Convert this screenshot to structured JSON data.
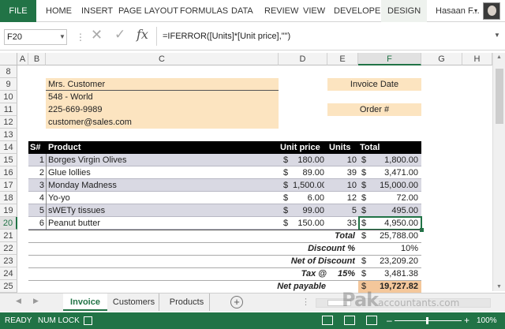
{
  "ribbon": {
    "file": "FILE",
    "tabs": [
      "HOME",
      "INSERT",
      "PAGE LAYOUT",
      "FORMULAS",
      "DATA",
      "REVIEW",
      "VIEW",
      "DEVELOPER"
    ],
    "design": "DESIGN",
    "user": "Hasaan F...",
    "user_caret": "▾"
  },
  "formula_bar": {
    "name_box": "F20",
    "formula": "=IFERROR([Units]*[Unit price],\"\")",
    "cancel_icon": "✕",
    "enter_icon": "✓",
    "fx": "fx"
  },
  "columns": [
    "A",
    "B",
    "C",
    "D",
    "E",
    "F",
    "G",
    "H"
  ],
  "selected_column": "F",
  "rows": [
    "8",
    "9",
    "10",
    "11",
    "12",
    "13",
    "14",
    "15",
    "16",
    "17",
    "18",
    "19",
    "20",
    "21",
    "22",
    "23",
    "24",
    "25"
  ],
  "selected_row": "20",
  "customer": {
    "name": "Mrs. Customer",
    "address": "548 - World",
    "phone": "225-669-9989",
    "email": "customer@sales.com"
  },
  "invoice_date_label": "Invoice Date",
  "order_label": "Order #",
  "table": {
    "headers": [
      "S#",
      "Product",
      "Unit price",
      "Units",
      "Total"
    ],
    "rows": [
      {
        "sn": "1",
        "product": "Borges Virgin Olives",
        "cur": "$",
        "price": "180.00",
        "units": "10",
        "tcur": "$",
        "total": "1,800.00"
      },
      {
        "sn": "2",
        "product": "Glue lollies",
        "cur": "$",
        "price": "89.00",
        "units": "39",
        "tcur": "$",
        "total": "3,471.00"
      },
      {
        "sn": "3",
        "product": "Monday Madness",
        "cur": "$",
        "price": "1,500.00",
        "units": "10",
        "tcur": "$",
        "total": "15,000.00"
      },
      {
        "sn": "4",
        "product": "Yo-yo",
        "cur": "$",
        "price": "6.00",
        "units": "12",
        "tcur": "$",
        "total": "72.00"
      },
      {
        "sn": "5",
        "product": "sWETy tissues",
        "cur": "$",
        "price": "99.00",
        "units": "5",
        "tcur": "$",
        "total": "495.00"
      },
      {
        "sn": "6",
        "product": "Peanut butter",
        "cur": "$",
        "price": "150.00",
        "units": "33",
        "tcur": "$",
        "total": "4,950.00"
      }
    ]
  },
  "summary": {
    "total_label": "Total",
    "total_cur": "$",
    "total_value": "25,788.00",
    "discount_label": "Discount %",
    "discount_value": "10%",
    "net_discount_label": "Net of Discount",
    "net_discount_cur": "$",
    "net_discount_value": "23,209.20",
    "tax_label": "Tax @",
    "tax_rate": "15%",
    "tax_cur": "$",
    "tax_value": "3,481.38",
    "net_payable_label": "Net payable",
    "net_payable_cur": "$",
    "net_payable_value": "19,727.82"
  },
  "sheets": [
    "Invoice",
    "Customers",
    "Products"
  ],
  "add_sheet": "+",
  "watermark": {
    "big": "Pak",
    "small": "accountants.com"
  },
  "status": {
    "ready": "READY",
    "numlock": "NUM LOCK",
    "zoom": "100%",
    "zoom_minus": "–",
    "zoom_plus": "+"
  },
  "colors": {
    "excel_green": "#217346",
    "customer_fill": "#fce4c0",
    "header_fill": "#000000",
    "band_fill": "#d9d9e3",
    "net_payable_fill": "#f4c79b"
  }
}
